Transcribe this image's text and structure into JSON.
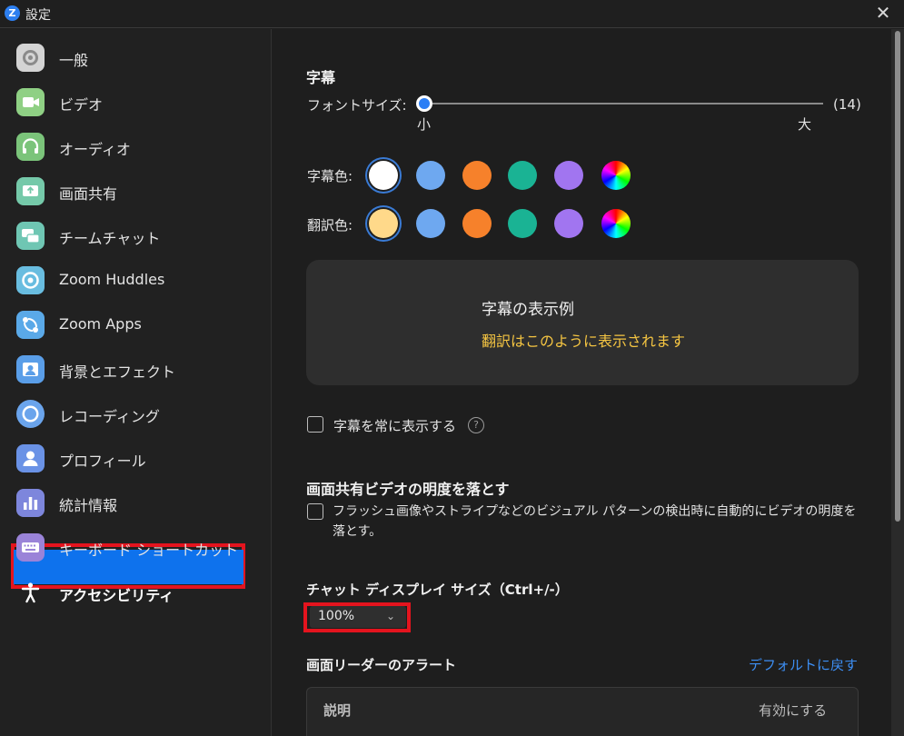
{
  "window": {
    "title": "設定",
    "logo_letter": "Z",
    "close_glyph": "✕"
  },
  "sidebar": {
    "items": [
      {
        "label": "一般",
        "icon": "gear-icon",
        "color": "#d4d4d4"
      },
      {
        "label": "ビデオ",
        "icon": "video-camera-icon",
        "color": "#8fd084"
      },
      {
        "label": "オーディオ",
        "icon": "headphones-icon",
        "color": "#7bc47a"
      },
      {
        "label": "画面共有",
        "icon": "share-screen-icon",
        "color": "#75c9a9"
      },
      {
        "label": "チームチャット",
        "icon": "chat-bubbles-icon",
        "color": "#6fc6b3"
      },
      {
        "label": "Zoom Huddles",
        "icon": "huddles-icon",
        "color": "#69bde0"
      },
      {
        "label": "Zoom Apps",
        "icon": "apps-icon",
        "color": "#5aa9e8"
      },
      {
        "label": "背景とエフェクト",
        "icon": "background-portrait-icon",
        "color": "#5a9ee8"
      },
      {
        "label": "レコーディング",
        "icon": "record-icon",
        "color": "#6aa4ec"
      },
      {
        "label": "プロフィール",
        "icon": "person-icon",
        "color": "#6a92e6"
      },
      {
        "label": "統計情報",
        "icon": "bar-chart-icon",
        "color": "#7d86dc"
      },
      {
        "label": "キーボード ショートカット",
        "icon": "keyboard-icon",
        "color": "#9a83d8"
      },
      {
        "label": "アクセシビリティ",
        "icon": "accessibility-icon",
        "color": "#0e72ed"
      }
    ],
    "active_index": 12
  },
  "captions": {
    "heading": "字幕",
    "font_size_label": "フォントサイズ:",
    "font_size_value": "(14)",
    "font_size_level": 0.0,
    "slider_min_label": "小",
    "slider_max_label": "大",
    "caption_color_label": "字幕色:",
    "translation_color_label": "翻訳色:",
    "caption_colors": [
      "#ffffff",
      "#6ea8f0",
      "#f6812b",
      "#1ab394",
      "#a175f0",
      "rainbow"
    ],
    "translation_colors": [
      "#ffd98a",
      "#6ea8f0",
      "#f6812b",
      "#1ab394",
      "#a175f0",
      "rainbow"
    ],
    "preview_title": "字幕の表示例",
    "preview_translation": "翻訳はこのように表示されます",
    "preview_translation_color": "#f5c542",
    "always_show_label": "字幕を常に表示する",
    "always_show_checked": false,
    "help_glyph": "?"
  },
  "dim_video": {
    "heading": "画面共有ビデオの明度を落とす",
    "checkbox_label_line1": "フラッシュ画像やストライプなどのビジュアル パターンの検出時に自動的にビデオの明度を",
    "checkbox_label_line2": "落とす。",
    "checked": false
  },
  "chat_display": {
    "heading": "チャット ディスプレイ サイズ（Ctrl+/-）",
    "selected": "100%",
    "chevron_glyph": "⌄"
  },
  "screen_reader": {
    "heading": "画面リーダーのアラート",
    "reset_link": "デフォルトに戻す",
    "link_color": "#3d8ff5",
    "col_description": "説明",
    "col_enable": "有効にする"
  },
  "accent": "#0e72ed",
  "highlight": "#e4141e"
}
